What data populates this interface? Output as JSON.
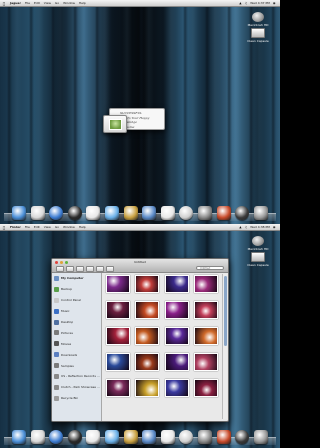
{
  "menubar": {
    "app": "Jaguar",
    "items": [
      "File",
      "Edit",
      "View",
      "Go",
      "Window",
      "Help"
    ],
    "clock": "Wed 4:37 PM"
  },
  "menubar_bottom": {
    "app": "Finder",
    "items": [
      "File",
      "Edit",
      "View",
      "Go",
      "Window",
      "Help"
    ],
    "clock": "Wed 4:38 PM"
  },
  "desktop": {
    "hd_label": "Macintosh HD",
    "drive_label": "Clean Capsule"
  },
  "notification": {
    "line1": "SUCCESSFUL",
    "line2": "Add To Your Happy Knowledge",
    "line3": "Awesome"
  },
  "finder": {
    "title": "Untitled",
    "search_placeholder": "Untitled",
    "sidebar": [
      {
        "label": "My Computer",
        "color": "#6a8fc2",
        "head": true
      },
      {
        "label": "Backup",
        "color": "#5aa04a"
      },
      {
        "label": "Control Panel",
        "color": "#c8c8c8"
      },
      {
        "label": "Music",
        "color": "#3b6fc4"
      },
      {
        "label": "Desktop",
        "color": "#4f6fa0"
      },
      {
        "label": "Pictures",
        "color": "#7a7a7a"
      },
      {
        "label": "Movies",
        "color": "#555555"
      },
      {
        "label": "Downloads",
        "color": "#5b7fc0"
      },
      {
        "label": "Samples",
        "color": "#7a7a7a"
      },
      {
        "label": "US - Reflection Records HD",
        "color": "#888888"
      },
      {
        "label": "Clutch - Park Showcase (HD)",
        "color": "#888888"
      },
      {
        "label": "Recycle Bin",
        "color": "#9a9a9a"
      }
    ],
    "thumbnails": [
      {
        "caption": "",
        "color": "#7c2a8c"
      },
      {
        "caption": "",
        "color": "#c23d3a"
      },
      {
        "caption": "",
        "color": "#3b2a8c"
      },
      {
        "caption": "",
        "color": "#9a2a7a"
      },
      {
        "caption": "",
        "color": "#6b1f3f"
      },
      {
        "caption": "",
        "color": "#c44a22"
      },
      {
        "caption": "",
        "color": "#8a1f8a"
      },
      {
        "caption": "",
        "color": "#c33f5a"
      },
      {
        "caption": "",
        "color": "#a3203a"
      },
      {
        "caption": "",
        "color": "#c25a20"
      },
      {
        "caption": "",
        "color": "#5a2a9a"
      },
      {
        "caption": "",
        "color": "#d06a2a"
      },
      {
        "caption": "",
        "color": "#2a4a9a"
      },
      {
        "caption": "",
        "color": "#9a3a1a"
      },
      {
        "caption": "",
        "color": "#4a1a7a"
      },
      {
        "caption": "",
        "color": "#b04060"
      },
      {
        "caption": "",
        "color": "#7a2a5a"
      },
      {
        "caption": "",
        "color": "#c8a02a"
      },
      {
        "caption": "",
        "color": "#3a3aa0"
      },
      {
        "caption": "",
        "color": "#8a2040"
      }
    ]
  },
  "dock": [
    {
      "icon": "finder-icon",
      "color": "#4a8fd8"
    },
    {
      "icon": "mail-icon",
      "color": "#d8d8d8"
    },
    {
      "icon": "safari-icon",
      "color": "#3a7ad0"
    },
    {
      "icon": "clock-icon",
      "color": "#2a2a2a"
    },
    {
      "icon": "ical-icon",
      "color": "#e8e8e8"
    },
    {
      "icon": "ichat-icon",
      "color": "#6ab0e8"
    },
    {
      "icon": "pencil-icon",
      "color": "#c8a040"
    },
    {
      "icon": "photo-icon",
      "color": "#5a8ac8"
    },
    {
      "icon": "preview-icon",
      "color": "#e8e8e8"
    },
    {
      "icon": "spiral-icon",
      "color": "#cfcfcf"
    },
    {
      "icon": "preferences-icon",
      "color": "#8a8a8a"
    },
    {
      "icon": "stamp-icon",
      "color": "#c84a2a"
    },
    {
      "icon": "itunes-icon",
      "color": "#3a3a3a"
    },
    {
      "icon": "trash-icon",
      "color": "#9a9a9a"
    }
  ]
}
